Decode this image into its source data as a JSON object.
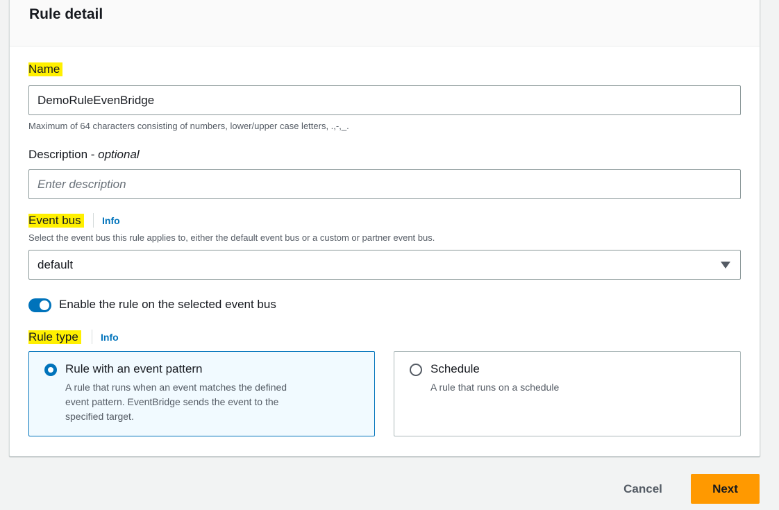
{
  "panel": {
    "title": "Rule detail"
  },
  "name_field": {
    "label": "Name",
    "value": "DemoRuleEvenBridge",
    "hint": "Maximum of 64 characters consisting of numbers, lower/upper case letters, .,-,_."
  },
  "description_field": {
    "label": "Description - ",
    "label_optional": "optional",
    "placeholder": "Enter description"
  },
  "event_bus": {
    "label": "Event bus",
    "info": "Info",
    "hint": "Select the event bus this rule applies to, either the default event bus or a custom or partner event bus.",
    "selected": "default"
  },
  "enable_toggle": {
    "label": "Enable the rule on the selected event bus",
    "checked": true
  },
  "rule_type": {
    "label": "Rule type",
    "info": "Info",
    "options": [
      {
        "title": "Rule with an event pattern",
        "desc_lines": [
          "A rule that runs when an event matches the defined",
          "event pattern. EventBridge sends the event to the",
          "specified target."
        ],
        "selected": true
      },
      {
        "title": "Schedule",
        "desc_lines": [
          "A rule that runs on a schedule"
        ],
        "selected": false
      }
    ]
  },
  "actions": {
    "cancel": "Cancel",
    "next": "Next"
  },
  "colors": {
    "highlight": "#fff000",
    "accent": "#0073bb",
    "primary_button": "#ff9900"
  }
}
